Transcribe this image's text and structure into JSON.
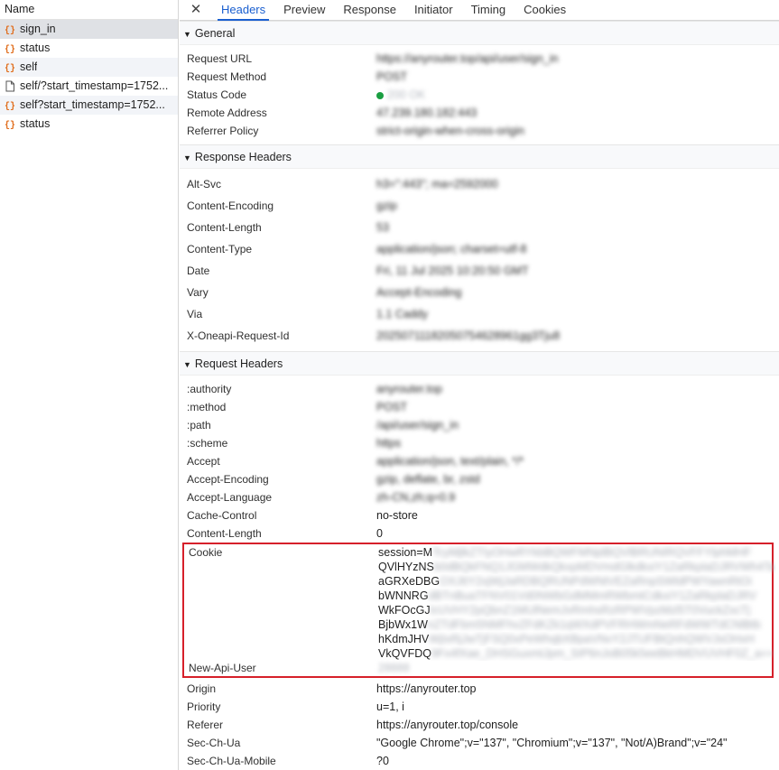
{
  "request_list": {
    "header": "Name",
    "items": [
      {
        "name": "sign_in",
        "icon": "json-braces-icon",
        "state": "selected"
      },
      {
        "name": "status",
        "icon": "json-braces-icon",
        "state": ""
      },
      {
        "name": "self",
        "icon": "json-braces-icon",
        "state": "alt"
      },
      {
        "name": "self/?start_timestamp=1752...",
        "icon": "document-icon",
        "state": ""
      },
      {
        "name": "self?start_timestamp=1752...",
        "icon": "json-braces-icon",
        "state": "alt"
      },
      {
        "name": "status",
        "icon": "json-braces-icon",
        "state": ""
      }
    ]
  },
  "tabs": {
    "close": "✕",
    "items": [
      "Headers",
      "Preview",
      "Response",
      "Initiator",
      "Timing",
      "Cookies"
    ],
    "active": "Headers"
  },
  "general": {
    "title": "General",
    "rows": [
      {
        "key": "Request URL",
        "value": "https://anyrouter.top/api/user/sign_in"
      },
      {
        "key": "Request Method",
        "value": "POST"
      },
      {
        "key": "Status Code",
        "value": "200 OK"
      },
      {
        "key": "Remote Address",
        "value": "47.239.180.182:443"
      },
      {
        "key": "Referrer Policy",
        "value": "strict-origin-when-cross-origin"
      }
    ]
  },
  "response_headers": {
    "title": "Response Headers",
    "rows": [
      {
        "key": "Alt-Svc",
        "value": "h3=\":443\"; ma=2592000"
      },
      {
        "key": "Content-Encoding",
        "value": "gzip"
      },
      {
        "key": "Content-Length",
        "value": "53"
      },
      {
        "key": "Content-Type",
        "value": "application/json; charset=utf-8"
      },
      {
        "key": "Date",
        "value": "Fri, 11 Jul 2025 10:20:50 GMT"
      },
      {
        "key": "Vary",
        "value": "Accept-Encoding"
      },
      {
        "key": "Via",
        "value": "1.1 Caddy"
      },
      {
        "key": "X-Oneapi-Request-Id",
        "value": "20250711182050754628961gg3Tju8"
      }
    ]
  },
  "request_headers": {
    "title": "Request Headers",
    "rows_top": [
      {
        "key": ":authority",
        "value": "anyrouter.top",
        "blurred": true
      },
      {
        "key": ":method",
        "value": "POST",
        "blurred": true
      },
      {
        "key": ":path",
        "value": "/api/user/sign_in",
        "blurred": true
      },
      {
        "key": ":scheme",
        "value": "https",
        "blurred": true
      },
      {
        "key": "Accept",
        "value": "application/json, text/plain, */*",
        "blurred": true
      },
      {
        "key": "Accept-Encoding",
        "value": "gzip, deflate, br, zstd",
        "blurred": true
      },
      {
        "key": "Accept-Language",
        "value": "zh-CN,zh;q=0.9",
        "blurred": true
      },
      {
        "key": "Cache-Control",
        "value": "no-store",
        "blurred": false
      },
      {
        "key": "Content-Length",
        "value": "0",
        "blurred": false
      }
    ],
    "cookie": {
      "key": "Cookie",
      "lines": [
        {
          "clear": "session=M",
          "hidden": "TcyMjlkZTIyOHwRYkbBQWFMNjdBQVlBRUNIRQVFFYlphMHF"
        },
        {
          "clear": "QVlHYzNS",
          "hidden": "b0dBQkFNQ1JGMWdkQkxpMDVmdGlkdkxiY1ZaRkplaDJRVWh4Ta"
        },
        {
          "clear": "aGRXeDBG",
          "hidden": "OXJ6Y2xjWjJaRDBQRUNPdWNtVEZaRnpSWldPWYawnRtOi"
        },
        {
          "clear": "bWNNRG",
          "hidden": "dBTnBuaTFNV01Vd0NWbGdMMmRWbmtCdkxiY1ZaRkplaDJRV"
        },
        {
          "clear": "WkFOcGJ",
          "hidden": "lcUVHY2pQbnZ1MUlNemJvRmhsRzRPWVpzMzl5T0VuckZxcTj"
        },
        {
          "clear": "BjbWx1W",
          "hidden": "nZTdFbm5NMFhvZFdKZk1qWXdPVFRHWmNeRFdWWTdCNlBtb"
        },
        {
          "clear": "hKdmJHV",
          "hidden": "WjIxRjJwTjFSQ0xPeWhqbXBpaVNvY2JTUFBtQnhQWVJsOHxH"
        },
        {
          "clear": "VkQVFDQ",
          "hidden": "9Fx4fXae_DHSGuxmtJpm_SIP6nJoB05k5eeBkHMDVUVHF0Z_a=="
        }
      ]
    },
    "new_api_user": {
      "key": "New-Api-User",
      "value": "28888"
    },
    "rows_bottom": [
      {
        "key": "Origin",
        "value": "https://anyrouter.top"
      },
      {
        "key": "Priority",
        "value": "u=1, i"
      },
      {
        "key": "Referer",
        "value": "https://anyrouter.top/console"
      },
      {
        "key": "Sec-Ch-Ua",
        "value": "\"Google Chrome\";v=\"137\", \"Chromium\";v=\"137\", \"Not/A)Brand\";v=\"24\""
      },
      {
        "key": "Sec-Ch-Ua-Mobile",
        "value": "?0"
      }
    ]
  },
  "colors": {
    "accent": "#1a5fd0",
    "highlight_box": "#d6202a",
    "status_ok": "#1a9e41",
    "json_icon": "#e06c1a"
  }
}
